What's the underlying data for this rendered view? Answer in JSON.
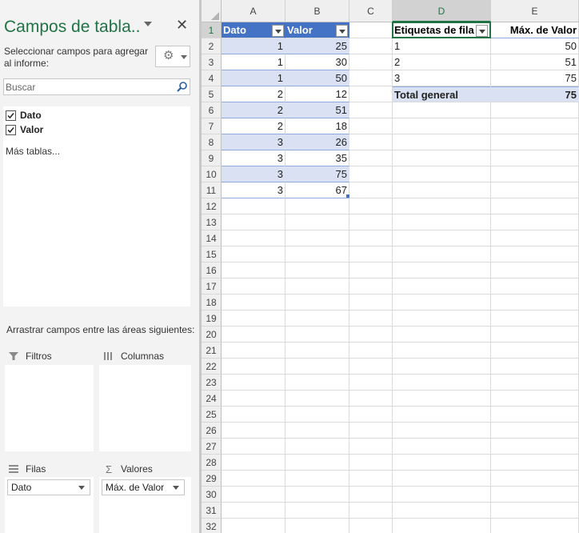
{
  "pane": {
    "title": "Campos de tabla..",
    "subtitle": "Seleccionar campos para agregar al informe:",
    "close_glyph": "✕",
    "tools_icon": "gear-icon",
    "search_placeholder": "Buscar",
    "fields": [
      {
        "label": "Dato",
        "checked": true
      },
      {
        "label": "Valor",
        "checked": true
      }
    ],
    "more_tables": "Más tablas...",
    "drag_label": "Arrastrar campos entre las áreas siguientes:",
    "areas": {
      "filters": {
        "label": "Filtros",
        "icon": "filter-icon"
      },
      "columns": {
        "label": "Columnas",
        "icon": "columns-icon"
      },
      "rows": {
        "label": "Filas",
        "icon": "rows-icon",
        "item": "Dato"
      },
      "values": {
        "label": "Valores",
        "icon": "sigma-icon",
        "item": "Máx. de Valor"
      }
    }
  },
  "accent_color": "#217346",
  "table_header_color": "#4472c4",
  "table_band_color": "#d9e1f2",
  "grid": {
    "columns": [
      "A",
      "B",
      "C",
      "D",
      "E"
    ],
    "selected_column": "D",
    "selected_row": "1",
    "rows": [
      "1",
      "2",
      "3",
      "4",
      "5",
      "6",
      "7",
      "8",
      "9",
      "10",
      "11",
      "12",
      "13",
      "14",
      "15",
      "16",
      "17",
      "18",
      "19",
      "20",
      "21",
      "22",
      "23",
      "24",
      "25",
      "26",
      "27",
      "28",
      "29",
      "30",
      "31",
      "32"
    ]
  },
  "table": {
    "headers": [
      "Dato",
      "Valor"
    ],
    "rows": [
      [
        "1",
        "25"
      ],
      [
        "1",
        "30"
      ],
      [
        "1",
        "50"
      ],
      [
        "2",
        "12"
      ],
      [
        "2",
        "51"
      ],
      [
        "2",
        "18"
      ],
      [
        "3",
        "26"
      ],
      [
        "3",
        "35"
      ],
      [
        "3",
        "75"
      ],
      [
        "3",
        "67"
      ]
    ]
  },
  "pivot": {
    "headers": [
      "Etiquetas de fila",
      "Máx. de Valor"
    ],
    "rows": [
      [
        "1",
        "50"
      ],
      [
        "2",
        "51"
      ],
      [
        "3",
        "75"
      ]
    ],
    "total_label": "Total general",
    "total_value": "75"
  }
}
